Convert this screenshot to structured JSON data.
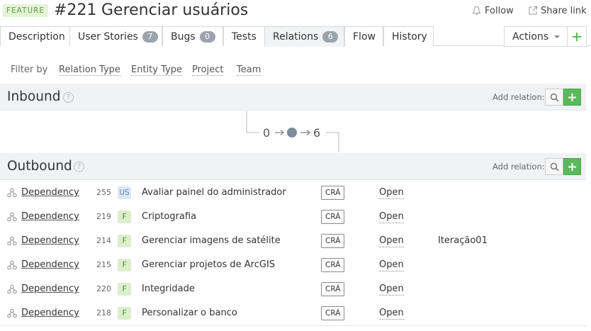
{
  "header": {
    "badge": "FEATURE",
    "id": "#221",
    "title": "Gerenciar usuários",
    "follow_label": "Follow",
    "share_label": "Share link"
  },
  "tabs": [
    {
      "label": "Description",
      "count": null
    },
    {
      "label": "User Stories",
      "count": "7"
    },
    {
      "label": "Bugs",
      "count": "0"
    },
    {
      "label": "Tests",
      "count": null
    },
    {
      "label": "Relations",
      "count": "6"
    },
    {
      "label": "Flow",
      "count": null
    },
    {
      "label": "History",
      "count": null
    }
  ],
  "active_tab": "Relations",
  "actions_label": "Actions",
  "filter": {
    "label": "Filter by",
    "items": [
      "Relation Type",
      "Entity Type",
      "Project",
      "Team"
    ]
  },
  "inbound": {
    "title": "Inbound",
    "help": "?",
    "add_relation_label": "Add relation:"
  },
  "flow": {
    "inbound_count": "0",
    "outbound_count": "6"
  },
  "outbound": {
    "title": "Outbound",
    "help": "?",
    "add_relation_label": "Add relation:",
    "rows": [
      {
        "type": "Dependency",
        "id": "255",
        "badge": "US",
        "name": "Avaliar painel do administrador",
        "project": "CRÁ",
        "state": "Open",
        "iteration": ""
      },
      {
        "type": "Dependency",
        "id": "219",
        "badge": "F",
        "name": "Criptografia",
        "project": "CRÁ",
        "state": "Open",
        "iteration": ""
      },
      {
        "type": "Dependency",
        "id": "214",
        "badge": "F",
        "name": "Gerenciar imagens de satélite",
        "project": "CRÁ",
        "state": "Open",
        "iteration": "Iteração01"
      },
      {
        "type": "Dependency",
        "id": "215",
        "badge": "F",
        "name": "Gerenciar projetos de ArcGIS",
        "project": "CRÁ",
        "state": "Open",
        "iteration": ""
      },
      {
        "type": "Dependency",
        "id": "220",
        "badge": "F",
        "name": "Integridade",
        "project": "CRÁ",
        "state": "Open",
        "iteration": ""
      },
      {
        "type": "Dependency",
        "id": "218",
        "badge": "F",
        "name": "Personalizar o banco",
        "project": "CRÁ",
        "state": "Open",
        "iteration": ""
      }
    ]
  },
  "colors": {
    "feature_badge_bg": "#e4f3d8",
    "feature_badge_fg": "#5d9a3a",
    "add_button": "#5cb85c",
    "section_bg": "#f0f2f4",
    "tab_count_bg": "#9ba3ab"
  },
  "icons": {
    "follow": "bell-icon",
    "share": "share-link-icon",
    "search": "search-icon",
    "add": "plus-icon",
    "relation": "dependency-relation-icon"
  }
}
